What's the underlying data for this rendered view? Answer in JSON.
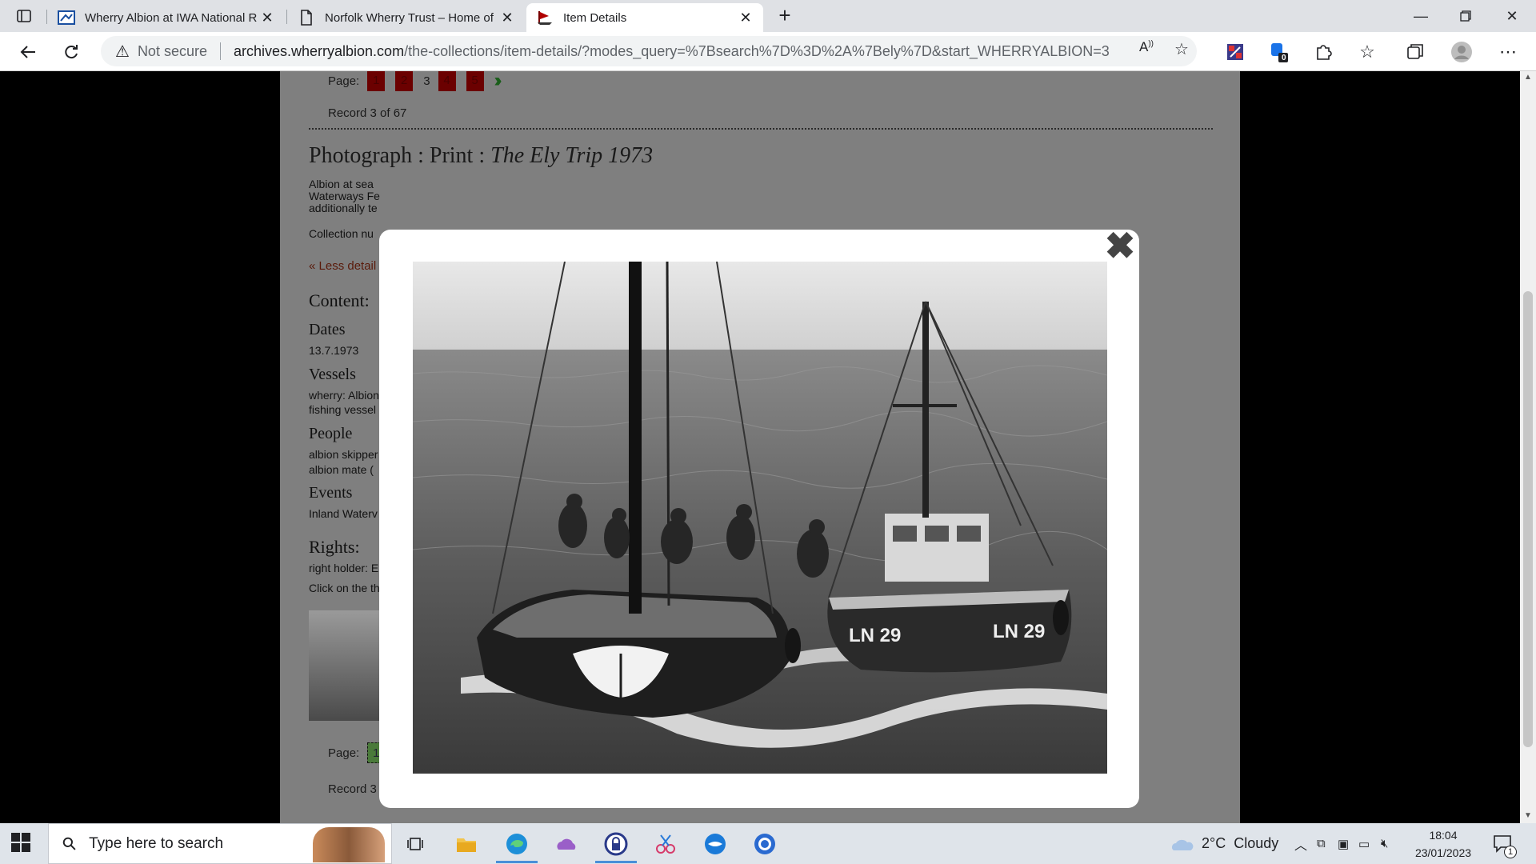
{
  "browser": {
    "tabs": [
      {
        "title": "Wherry Albion at IWA National R",
        "active": false
      },
      {
        "title": "Norfolk Wherry Trust – Home of",
        "active": false
      },
      {
        "title": "Item Details",
        "active": true
      }
    ],
    "address": {
      "security_label": "Not secure",
      "host": "archives.wherryalbion.com",
      "path": "/the-collections/item-details/?modes_query=%7Bsearch%7D%3D%2A%7Bely%7D&start_WHERRYALBION=3"
    },
    "badge_count": "0"
  },
  "page": {
    "pager_label": "Page:",
    "pages": [
      "1",
      "2",
      "3",
      "4",
      "5"
    ],
    "current_page": "3",
    "next_symbol": "»",
    "record_text": "Record 3 of 67",
    "heading_prefix": "Photograph : Print : ",
    "heading_title": "The Ely Trip 1973",
    "desc_line1": "Albion at sea",
    "desc_line2": "Waterways Fe",
    "desc_line3": "additionally te",
    "collection_label": "Collection nu",
    "less_detail": "« Less detail",
    "content_heading": "Content:",
    "dates_heading": "Dates",
    "dates_value": "13.7.1973",
    "vessels_heading": "Vessels",
    "vessels_line1": "wherry: Albion",
    "vessels_line2": "fishing vessel",
    "people_heading": "People",
    "people_line1": "albion skipper",
    "people_line2": "albion mate (",
    "events_heading": "Events",
    "events_line1": "Inland Waterv",
    "rights_heading": "Rights:",
    "rights_line1": "right holder: E",
    "click_text": "Click on the th"
  },
  "modal": {
    "close_symbol": "✖",
    "photo": {
      "alt_fishing_boat_reg": "LN 29"
    }
  },
  "taskbar": {
    "search_placeholder": "Type here to search",
    "weather_temp": "2°C",
    "weather_text": "Cloudy",
    "time": "18:04",
    "date": "23/01/2023",
    "notification_count": "1"
  }
}
